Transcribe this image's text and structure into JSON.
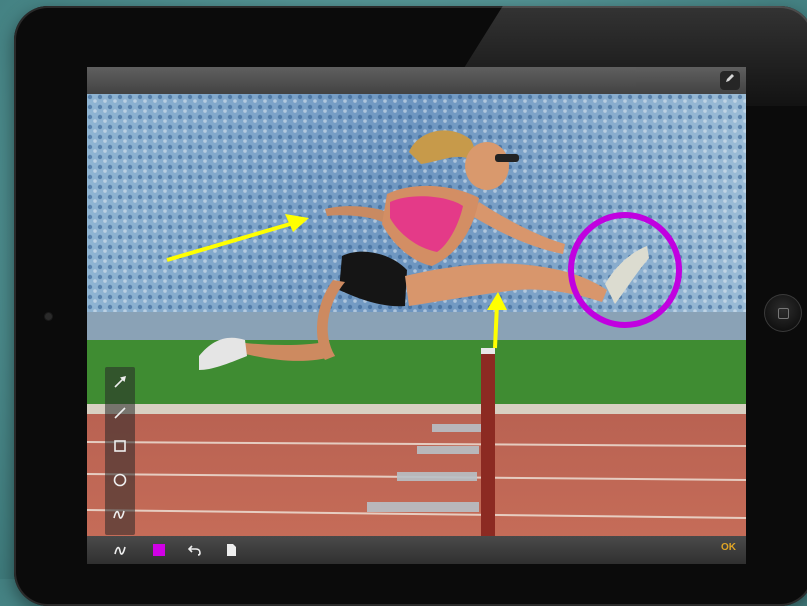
{
  "device": "ipad",
  "top_bar": {
    "edit_icon": "pencil-icon"
  },
  "tools": [
    {
      "name": "arrow-tool",
      "icon": "arrow-icon"
    },
    {
      "name": "line-tool",
      "icon": "line-icon"
    },
    {
      "name": "rectangle-tool",
      "icon": "square-icon"
    },
    {
      "name": "ellipse-tool",
      "icon": "circle-icon"
    },
    {
      "name": "freehand-tool",
      "icon": "scribble-icon"
    }
  ],
  "bottom_bar": {
    "current_tool_icon": "scribble-icon",
    "current_color": "#d100e6",
    "undo_icon": "undo-icon",
    "clear_icon": "page-icon",
    "ok_label": "OK"
  },
  "annotations": [
    {
      "type": "arrow",
      "color": "#ffff00"
    },
    {
      "type": "arrow",
      "color": "#ffff00"
    },
    {
      "type": "ellipse",
      "color": "#c100e0"
    }
  ]
}
